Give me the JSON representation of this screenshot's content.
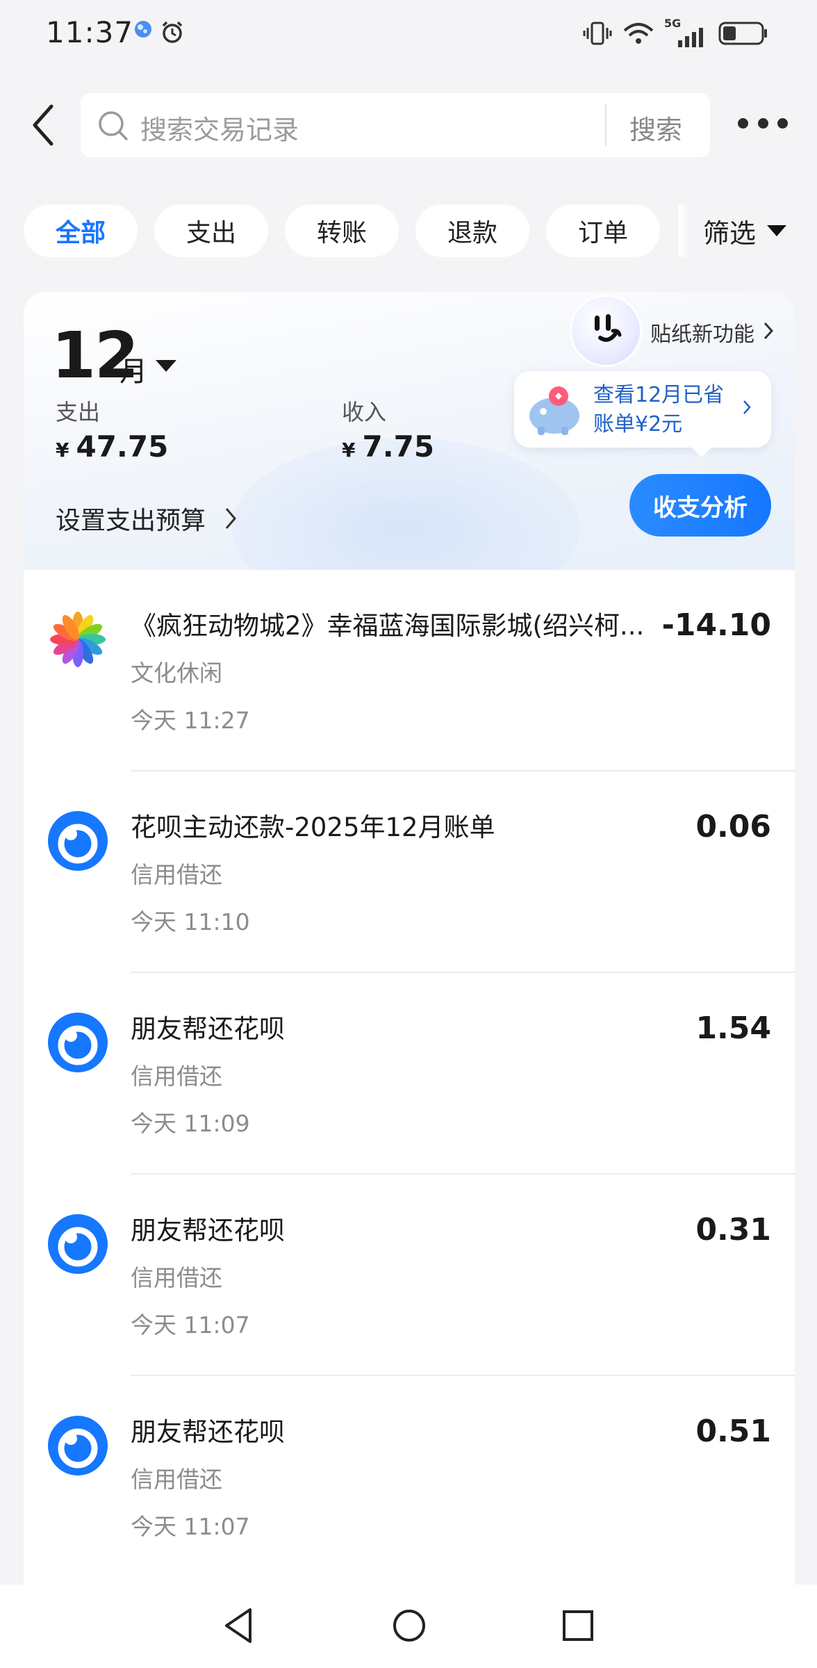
{
  "status_bar": {
    "time": "11:37",
    "network": "5G"
  },
  "header": {
    "back_icon": "chevron-left-icon",
    "search_placeholder": "搜索交易记录",
    "search_button": "搜索",
    "more_icon": "more-dots-icon"
  },
  "filters": {
    "chips": [
      "全部",
      "支出",
      "转账",
      "退款",
      "订单"
    ],
    "active": "全部",
    "filter_label": "筛选"
  },
  "summary": {
    "month_number": "12",
    "month_unit": "月",
    "expense_label": "支出",
    "expense_currency": "¥",
    "expense_value": "47.75",
    "income_label": "收入",
    "income_currency": "¥",
    "income_value": "7.75",
    "budget_label": "设置支出预算",
    "sticker_label": "贴纸新功能",
    "savings_line1": "查看12月已省",
    "savings_line2": "账单¥2元",
    "analysis_button": "收支分析"
  },
  "transactions": [
    {
      "title": "《疯狂动物城2》幸福蓝海国际影城(绍兴柯...",
      "category": "文化休闲",
      "time": "今天 11:27",
      "amount": "-14.10",
      "icon": "movie-pinwheel-icon"
    },
    {
      "title": "花呗主动还款-2025年12月账单",
      "category": "信用借还",
      "time": "今天 11:10",
      "amount": "0.06",
      "icon": "huabei-icon"
    },
    {
      "title": "朋友帮还花呗",
      "category": "信用借还",
      "time": "今天 11:09",
      "amount": "1.54",
      "icon": "huabei-icon"
    },
    {
      "title": "朋友帮还花呗",
      "category": "信用借还",
      "time": "今天 11:07",
      "amount": "0.31",
      "icon": "huabei-icon"
    },
    {
      "title": "朋友帮还花呗",
      "category": "信用借还",
      "time": "今天 11:07",
      "amount": "0.51",
      "icon": "huabei-icon"
    }
  ],
  "colors": {
    "accent": "#1677ff",
    "background": "#f4f4f6"
  }
}
